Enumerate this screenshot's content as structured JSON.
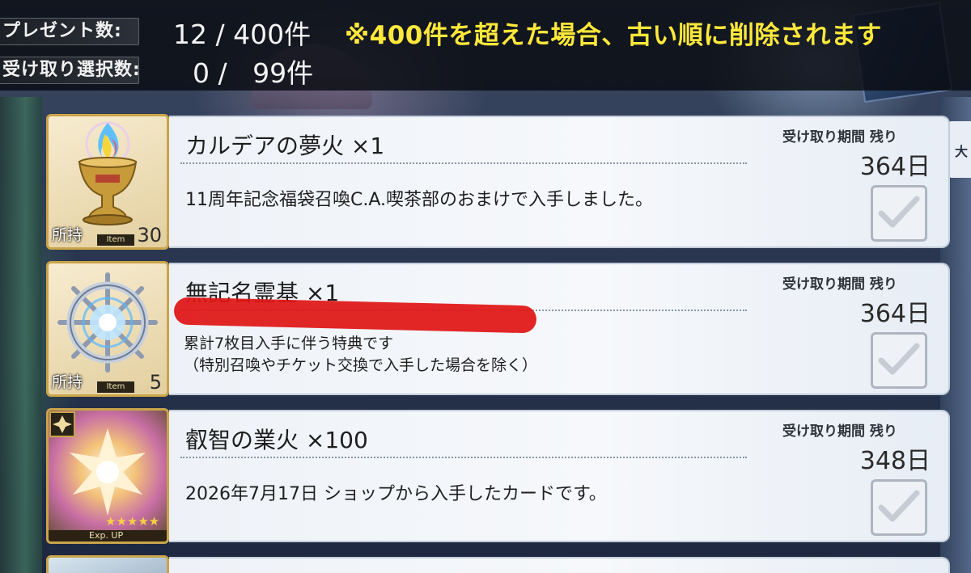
{
  "header": {
    "present_label": "プレゼント数:",
    "present_count": "12 / 400件",
    "notice": "※400件を超えた場合、古い順に削除されます",
    "select_label": "受け取り選択数:",
    "select_count": "0 /   99件"
  },
  "items": [
    {
      "name": "カルデアの夢火 ×1",
      "desc": [
        "11周年記念福袋召喚C.A.喫茶部のおまけで入手しました。"
      ],
      "period_label": "受け取り期間 残り",
      "days": "364日",
      "owned_label": "所持",
      "item_tag": "Item",
      "owned_count": "30",
      "icon": "golden-grail-flame-icon"
    },
    {
      "name": "無記名霊基 ×1",
      "desc": [
        "累計7枚目入手に伴う特典です",
        "（特別召喚やチケット交換で入手した場合を除く）"
      ],
      "period_label": "受け取り期間 残り",
      "days": "364日",
      "owned_label": "所持",
      "item_tag": "Item",
      "owned_count": "5",
      "icon": "saint-quartz-wheel-icon"
    },
    {
      "name": "叡智の業火 ×100",
      "desc": [
        "2026年7月17日 ショップから入手したカードです。"
      ],
      "period_label": "受け取り期間 残り",
      "days": "348日",
      "icon_label": "Exp. UP",
      "icon": "exp-card-icon"
    }
  ],
  "colors": {
    "notice": "#ffe83a",
    "frame_gold": "#c9a44a",
    "redaction": "#e01515"
  }
}
